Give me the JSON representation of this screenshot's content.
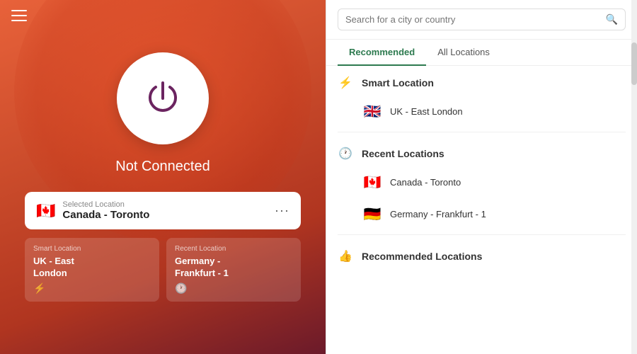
{
  "left": {
    "connection_status": "Not Connected",
    "selected_location_label": "Selected Location",
    "selected_location_name": "Canada - Toronto",
    "selected_flag": "🇨🇦",
    "dots_label": "···",
    "shortcuts": [
      {
        "label": "Smart Location",
        "name": "UK - East\nLondon",
        "icon": "⚡"
      },
      {
        "label": "Recent Location",
        "name": "Germany -\nFrankfurt - 1",
        "icon": "🕐"
      }
    ]
  },
  "right": {
    "search_placeholder": "Search for a city or country",
    "tabs": [
      {
        "label": "Recommended",
        "active": true
      },
      {
        "label": "All Locations",
        "active": false
      }
    ],
    "sections": [
      {
        "title": "Smart Location",
        "icon": "⚡",
        "items": [
          {
            "flag": "🇬🇧",
            "name": "UK - East London"
          }
        ]
      },
      {
        "title": "Recent Locations",
        "icon": "🕐",
        "items": [
          {
            "flag": "🇨🇦",
            "name": "Canada - Toronto"
          },
          {
            "flag": "🇩🇪",
            "name": "Germany - Frankfurt - 1"
          }
        ]
      },
      {
        "title": "Recommended Locations",
        "icon": "👍",
        "items": []
      }
    ]
  }
}
